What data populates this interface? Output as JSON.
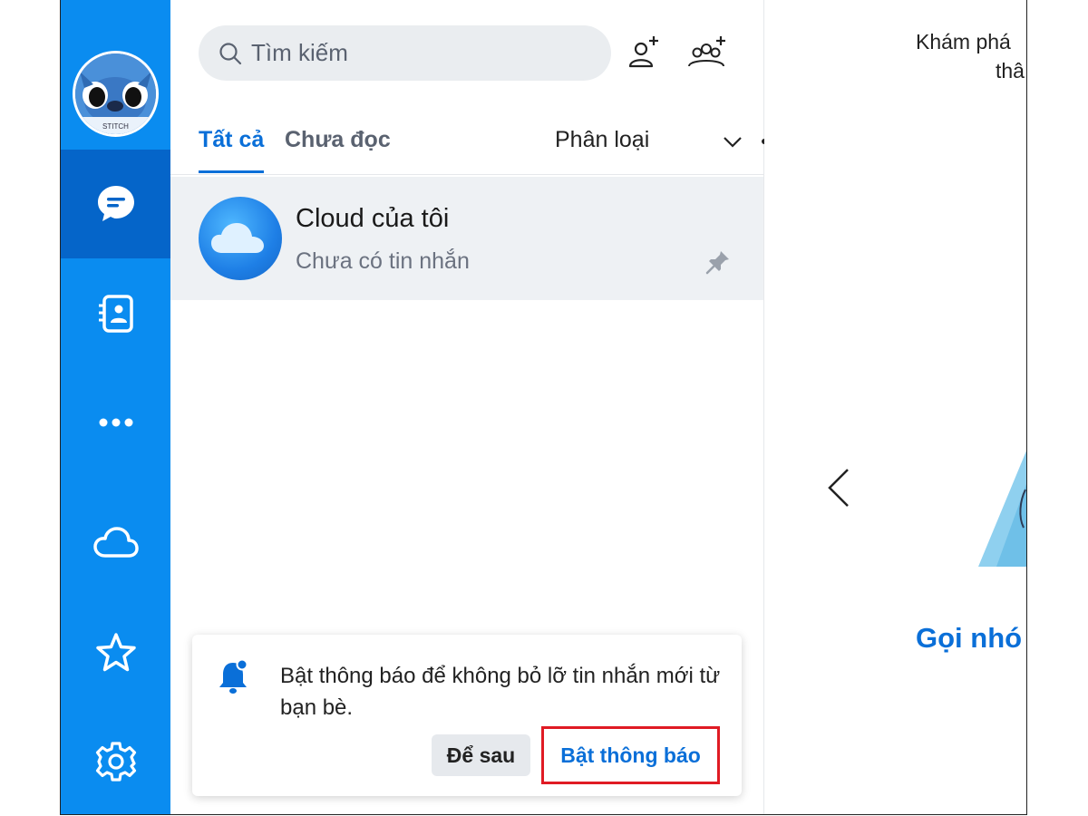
{
  "sidebar": {
    "avatar_label": "STITCH",
    "items": [
      {
        "name": "messages",
        "icon": "chat-icon",
        "active": true
      },
      {
        "name": "contacts",
        "icon": "contacts-icon",
        "active": false
      },
      {
        "name": "more",
        "icon": "more-icon",
        "active": false
      },
      {
        "name": "cloud",
        "icon": "cloud-icon",
        "active": false
      },
      {
        "name": "favorites",
        "icon": "star-icon",
        "active": false
      },
      {
        "name": "settings",
        "icon": "gear-icon",
        "active": false
      }
    ],
    "color": "#0a8cf0",
    "active_color": "#0565c9"
  },
  "search": {
    "placeholder": "Tìm kiếm"
  },
  "header_icons": [
    "add-friend-icon",
    "create-group-icon"
  ],
  "tabs": [
    {
      "label": "Tất cả",
      "active": true
    },
    {
      "label": "Chưa đọc",
      "active": false
    }
  ],
  "filter": {
    "label": "Phân loại"
  },
  "conversations": [
    {
      "name": "Cloud của tôi",
      "preview": "Chưa có tin nhắn",
      "pinned": true
    }
  ],
  "notice": {
    "text": "Bật thông báo để không bỏ lỡ tin nhắn mới từ bạn bè.",
    "later_label": "Để sau",
    "enable_label": "Bật thông báo"
  },
  "right_pane": {
    "welcome_line1": "Khám phá",
    "welcome_line2": "thâ",
    "slide_title": "Gọi nhó"
  },
  "accent": "#0a6fd8"
}
